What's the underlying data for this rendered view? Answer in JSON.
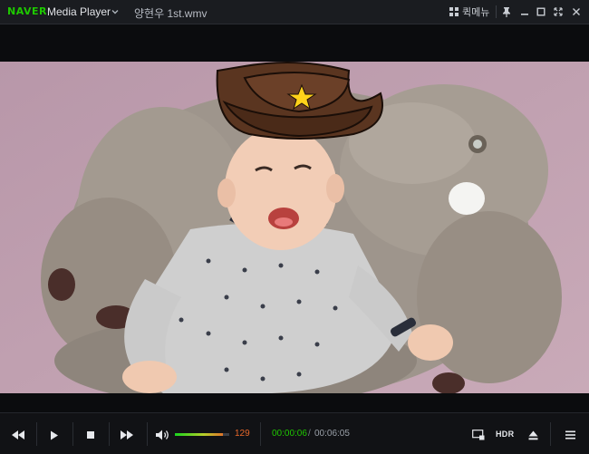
{
  "titlebar": {
    "brand": "NAVER",
    "app_name": "Media Player",
    "file_name": "양현우 1st.wmv",
    "quick_menu_label": "퀵메뉴",
    "icons": [
      "chevron-down-icon",
      "grid-icon",
      "pin-icon",
      "minimize-icon",
      "maximize-icon",
      "fullscreen-icon",
      "close-icon"
    ]
  },
  "playback": {
    "current_time": "00:00:06",
    "time_separator": "/",
    "total_time": "00:06:05",
    "progress_fraction": 0.016
  },
  "volume": {
    "value": "129",
    "level_fraction": 0.88
  },
  "controls": {
    "hdr_label": "HDR",
    "icons": [
      "rewind-icon",
      "play-icon",
      "stop-icon",
      "fast-forward-icon",
      "speaker-icon",
      "screen-capture-icon",
      "eject-icon",
      "menu-icon"
    ]
  },
  "colors": {
    "brand_green": "#1ec800",
    "volume_orange": "#e8682a",
    "background": "#0b0c0e"
  }
}
